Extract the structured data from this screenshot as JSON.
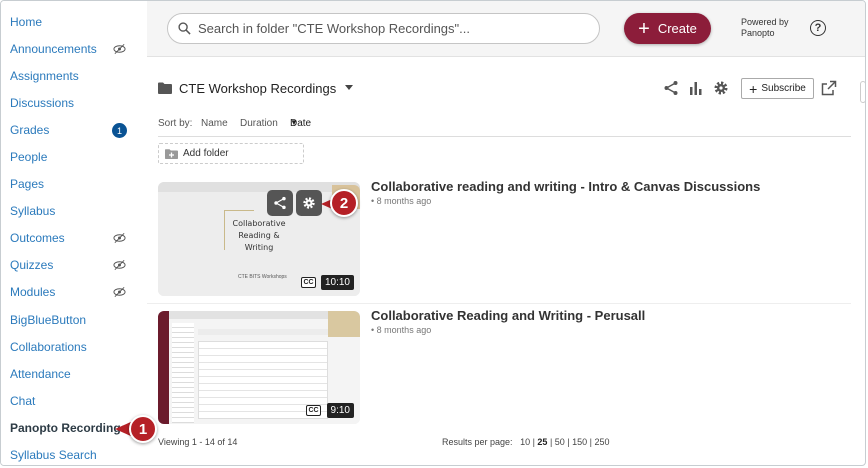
{
  "sidebar": {
    "items": [
      {
        "label": "Home"
      },
      {
        "label": "Announcements",
        "hidden": true
      },
      {
        "label": "Assignments"
      },
      {
        "label": "Discussions"
      },
      {
        "label": "Grades",
        "badge": "1"
      },
      {
        "label": "People"
      },
      {
        "label": "Pages"
      },
      {
        "label": "Syllabus"
      },
      {
        "label": "Outcomes",
        "hidden": true
      },
      {
        "label": "Quizzes",
        "hidden": true
      },
      {
        "label": "Modules",
        "hidden": true
      },
      {
        "label": "BigBlueButton"
      },
      {
        "label": "Collaborations"
      },
      {
        "label": "Attendance"
      },
      {
        "label": "Chat"
      },
      {
        "label": "Panopto Recordings",
        "active": true
      },
      {
        "label": "Syllabus Search"
      }
    ]
  },
  "header": {
    "search_placeholder": "Search in folder \"CTE Workshop Recordings\"...",
    "create_label": "Create",
    "powered_line1": "Powered by",
    "powered_line2": "Panopto",
    "help_label": "?"
  },
  "folder": {
    "name": "CTE Workshop Recordings",
    "subscribe_label": "Subscribe",
    "add_folder_label": "Add folder"
  },
  "sort": {
    "label": "Sort by:",
    "options": [
      "Name",
      "Duration",
      "Date"
    ],
    "active": "Date"
  },
  "sessions": [
    {
      "title": "Collaborative reading and writing - Intro & Canvas Discussions",
      "date": "8 months ago",
      "duration": "10:10",
      "cc": "CC",
      "thumb_text": [
        "Collaborative",
        "Reading &",
        "Writing"
      ],
      "thumb_sub": "CTE BITS Workshops"
    },
    {
      "title": "Collaborative Reading and Writing - Perusall",
      "date": "8 months ago",
      "duration": "9:10",
      "cc": "CC"
    }
  ],
  "callouts": [
    "1",
    "2"
  ],
  "footer": {
    "viewing": "Viewing 1 - 14 of 14",
    "results_label": "Results per page:",
    "page_sizes": [
      "10",
      "25",
      "50",
      "150",
      "250"
    ],
    "current_page_size": "25"
  },
  "colors": {
    "accent": "#8c1d3a",
    "link": "#2b7abc",
    "callout": "#b52026",
    "badge": "#0a5394"
  }
}
